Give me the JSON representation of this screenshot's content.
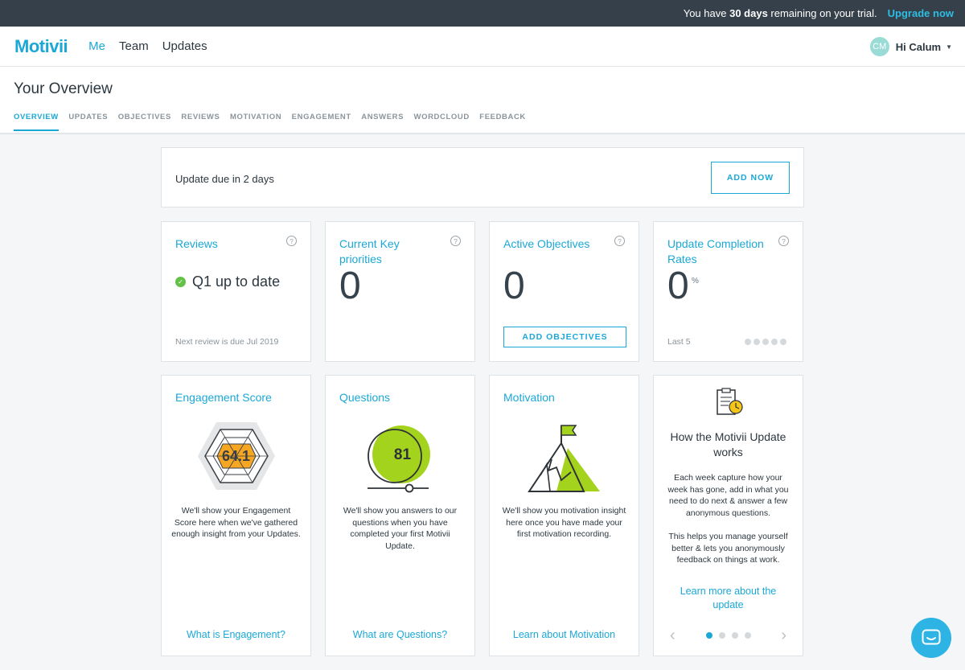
{
  "trial": {
    "prefix": "You have",
    "days": "30 days",
    "suffix": "remaining on your trial.",
    "upgrade": "Upgrade now"
  },
  "nav": {
    "logo": "Motivii",
    "links": [
      "Me",
      "Team",
      "Updates"
    ],
    "active": "Me",
    "user_initials": "CM",
    "user_greeting": "Hi Calum"
  },
  "page": {
    "title": "Your Overview",
    "tabs": [
      "OVERVIEW",
      "UPDATES",
      "OBJECTIVES",
      "REVIEWS",
      "MOTIVATION",
      "ENGAGEMENT",
      "ANSWERS",
      "WORDCLOUD",
      "FEEDBACK"
    ],
    "active_tab": "OVERVIEW"
  },
  "update": {
    "text": "Update due in 2 days",
    "button": "ADD NOW"
  },
  "reviews": {
    "title": "Reviews",
    "status": "Q1 up to date",
    "footer": "Next review is due Jul 2019"
  },
  "priorities": {
    "title": "Current Key priorities",
    "value": "0"
  },
  "objectives": {
    "title": "Active Objectives",
    "value": "0",
    "button": "ADD OBJECTIVES"
  },
  "completion": {
    "title": "Update Completion Rates",
    "value": "0",
    "unit": "%",
    "footer": "Last 5",
    "dots": 5
  },
  "engagement": {
    "title": "Engagement Score",
    "score": "64.1",
    "desc": "We'll show your Engagement Score here when we've gathered enough insight from your Updates.",
    "link": "What is Engagement?"
  },
  "questions": {
    "title": "Questions",
    "score": "81",
    "desc": "We'll show you answers to our questions when you have completed your first Motivii Update.",
    "link": "What are Questions?"
  },
  "motivation": {
    "title": "Motivation",
    "desc": "We'll show you motivation insight here once you have made your first motivation recording.",
    "link": "Learn about Motivation"
  },
  "how": {
    "title": "How the Motivii Update works",
    "p1": "Each week capture how your week has gone, add in what you need to do next & answer a few anonymous questions.",
    "p2": "This helps you manage yourself better & lets you anonymously feedback on things at work.",
    "link": "Learn more about the update",
    "slides": 4,
    "active_slide": 1
  },
  "colors": {
    "brand": "#1ba8d6",
    "banner": "#35404a",
    "success": "#62c146",
    "accent_green": "#a4d31d",
    "hex_orange": "#f5a623"
  },
  "help_glyph": "?"
}
